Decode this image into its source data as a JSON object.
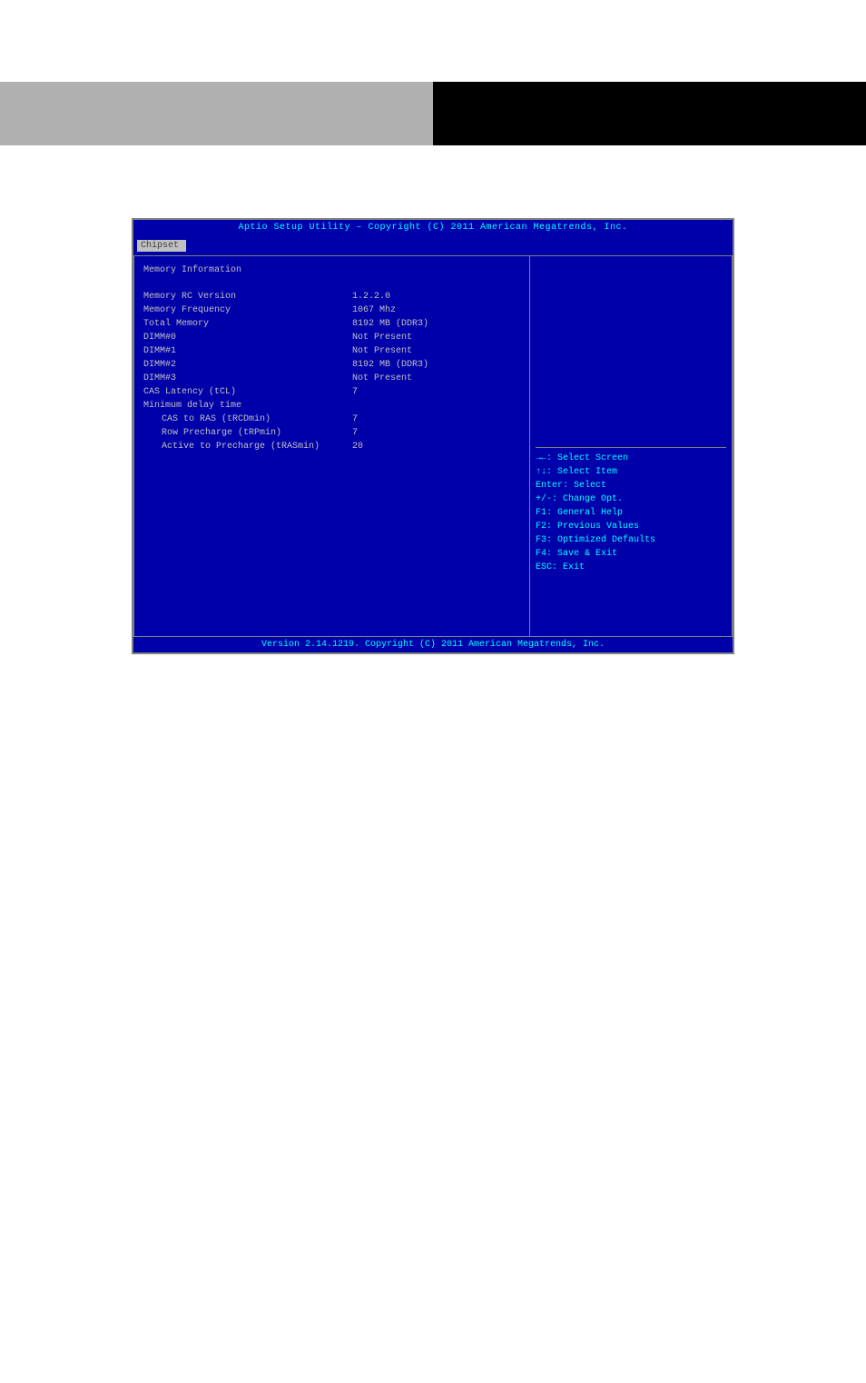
{
  "header_text": "Aptio Setup Utility – Copyright (C) 2011 American Megatrends, Inc.",
  "tabs": {
    "active": "Chipset"
  },
  "main": {
    "section_title": "Memory Information",
    "rows": [
      {
        "label": "Memory RC Version",
        "value": "1.2.2.0"
      },
      {
        "label": "Memory Frequency",
        "value": "1067 Mhz"
      },
      {
        "label": "Total Memory",
        "value": "8192 MB (DDR3)"
      },
      {
        "label": "DIMM#0",
        "value": "Not Present"
      },
      {
        "label": "DIMM#1",
        "value": "Not Present"
      },
      {
        "label": "DIMM#2",
        "value": "8192 MB (DDR3)"
      },
      {
        "label": "DIMM#3",
        "value": "Not Present"
      },
      {
        "label": "CAS Latency (tCL)",
        "value": "7"
      },
      {
        "label": "Minimum delay time",
        "value": ""
      }
    ],
    "indented_rows": [
      {
        "label": "CAS to RAS (tRCDmin)",
        "value": "7"
      },
      {
        "label": "Row Precharge (tRPmin)",
        "value": "7"
      },
      {
        "label": "Active to Precharge (tRASmin)",
        "value": "20"
      }
    ]
  },
  "help": {
    "lines": [
      "→←: Select Screen",
      "↑↓: Select Item",
      "Enter: Select",
      "+/-: Change Opt.",
      "F1: General Help",
      "F2: Previous Values",
      "F3: Optimized Defaults",
      "F4: Save & Exit",
      "ESC: Exit"
    ]
  },
  "footer_text": "Version 2.14.1219. Copyright (C) 2011 American Megatrends, Inc."
}
